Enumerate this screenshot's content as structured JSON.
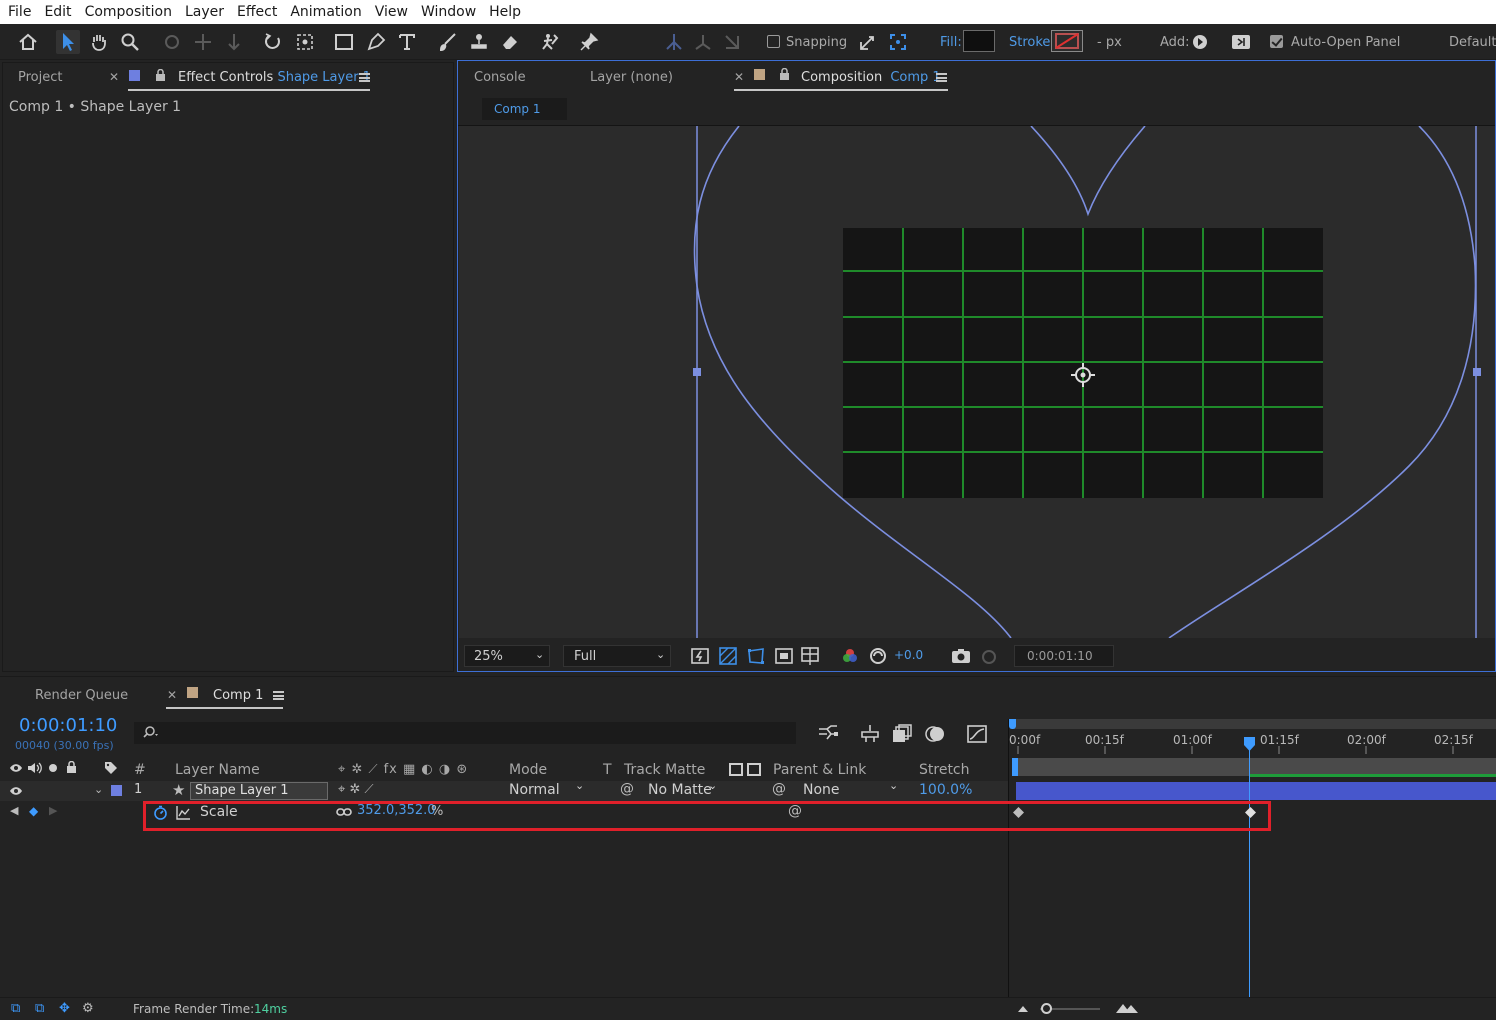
{
  "menu": [
    "File",
    "Edit",
    "Composition",
    "Layer",
    "Effect",
    "Animation",
    "View",
    "Window",
    "Help"
  ],
  "toolbar": {
    "snapping_label": "Snapping",
    "fill_label": "Fill:",
    "stroke_label": "Stroke:",
    "stroke_px": "- px",
    "add_label": "Add:",
    "auto_open_label": "Auto-Open Panel",
    "workspace_label": "Default"
  },
  "left_panel": {
    "tab_project": "Project",
    "tab_effect_controls": "Effect Controls",
    "tab_effect_controls_layer": "Shape Layer 1",
    "breadcrumb": "Comp 1 • Shape Layer 1"
  },
  "comp_panel": {
    "tab_console": "Console",
    "tab_layer": "Layer (none)",
    "tab_composition": "Composition",
    "tab_composition_name": "Comp 1",
    "comp_subtab": "Comp 1",
    "zoom": "25%",
    "resolution": "Full",
    "exposure": "+0.0",
    "timecode": "0:00:01:10"
  },
  "timeline": {
    "tab_render_queue": "Render Queue",
    "tab_comp": "Comp 1",
    "current_time": "0:00:01:10",
    "frame_info": "00040 (30.00 fps)",
    "search_placeholder": "",
    "columns": {
      "num": "#",
      "layer_name": "Layer Name",
      "mode": "Mode",
      "t": "T",
      "track_matte": "Track Matte",
      "parent": "Parent & Link",
      "stretch": "Stretch"
    },
    "layer": {
      "index": "1",
      "name": "Shape Layer 1",
      "mode": "Normal",
      "track_matte": "No Matte",
      "parent": "None",
      "stretch": "100.0%"
    },
    "property": {
      "name": "Scale",
      "value": "352.0,352.0",
      "unit": "%"
    },
    "ruler": [
      "0:00f",
      "00:15f",
      "01:00f",
      "01:15f",
      "02:00f",
      "02:15f"
    ],
    "status": {
      "render_time_label": "Frame Render Time:",
      "render_time_value": "14ms"
    }
  },
  "colors": {
    "accent_blue": "#4f9be8",
    "highlight_red": "#e0202a",
    "grid_green": "#1f8a2a",
    "path_blue": "#7c8fe0",
    "layer_bar": "#4a5bd0"
  }
}
